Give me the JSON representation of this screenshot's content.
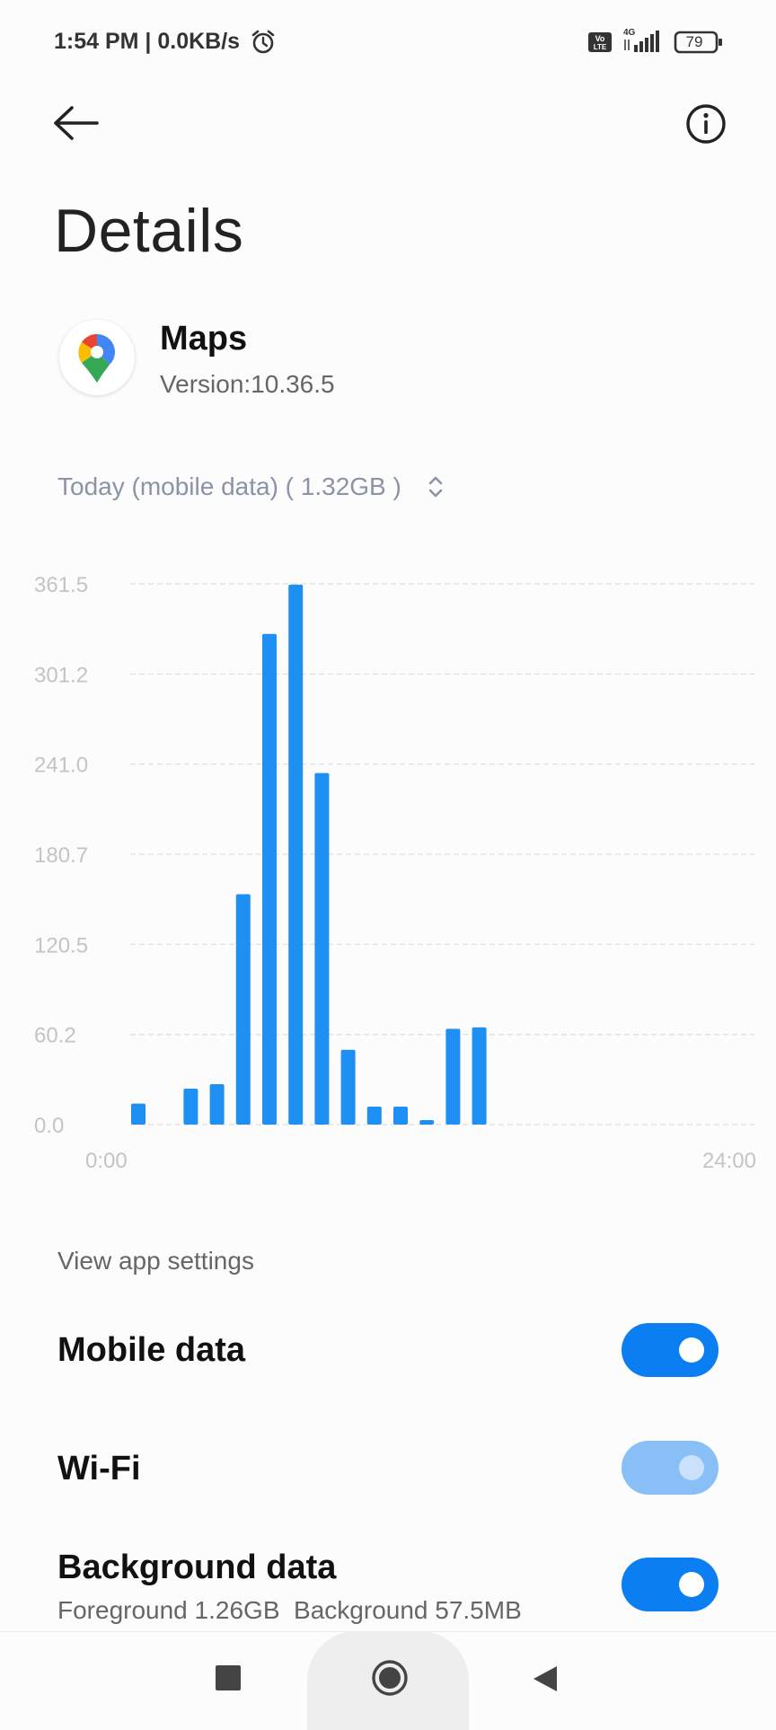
{
  "status_bar": {
    "time": "1:54 PM | 0.0KB/s",
    "battery_level": "79",
    "icons": [
      "alarm-icon",
      "volte-icon",
      "signal-4g-icon",
      "battery-icon"
    ]
  },
  "header": {
    "back_icon": "back-arrow-icon",
    "info_icon": "info-icon",
    "title": "Details"
  },
  "app": {
    "name": "Maps",
    "version": "Version:10.36.5",
    "icon": "google-maps-pin-icon"
  },
  "period": {
    "label": "Today (mobile data) ( 1.32GB )",
    "icon": "up-down-chevron-icon"
  },
  "colors": {
    "accent": "#0b7ff2",
    "bar": "#1e8ff3",
    "toggle_disabled": "#88bff6",
    "grid": "#dddddd",
    "axis_text": "#c4c4c4"
  },
  "chart_data": {
    "type": "bar",
    "title": "",
    "xlabel": "",
    "ylabel": "",
    "ylim": [
      0,
      361.5
    ],
    "y_ticks": [
      "0.0",
      "60.2",
      "120.5",
      "180.7",
      "241.0",
      "301.2",
      "361.5"
    ],
    "y_tick_values": [
      0,
      60.2,
      120.5,
      180.7,
      241.0,
      301.2,
      361.5
    ],
    "x_ticks": [
      "0:00",
      "24:00"
    ],
    "hours": [
      0,
      1,
      2,
      3,
      4,
      5,
      6,
      7,
      8,
      9,
      10,
      11,
      12,
      13,
      14,
      15,
      16,
      17,
      18,
      19,
      20,
      21,
      22,
      23
    ],
    "values": [
      14,
      0,
      24,
      27,
      154,
      328,
      361,
      235,
      50,
      12,
      12,
      3,
      64,
      65,
      0,
      0,
      0,
      0,
      0,
      0,
      0,
      0,
      0,
      0
    ],
    "grid": true,
    "legend": "none"
  },
  "settings": {
    "view_link": "View app settings",
    "mobile_data": {
      "label": "Mobile data",
      "enabled": true
    },
    "wifi": {
      "label": "Wi-Fi",
      "enabled": true,
      "disabled_look": true
    },
    "background_data": {
      "label": "Background data",
      "sublabel": "Foreground 1.26GB  Background 57.5MB",
      "enabled": true
    }
  },
  "nav": {
    "recent_icon": "recent-apps-square-icon",
    "home_icon": "home-circle-icon",
    "back_icon": "back-triangle-icon"
  }
}
